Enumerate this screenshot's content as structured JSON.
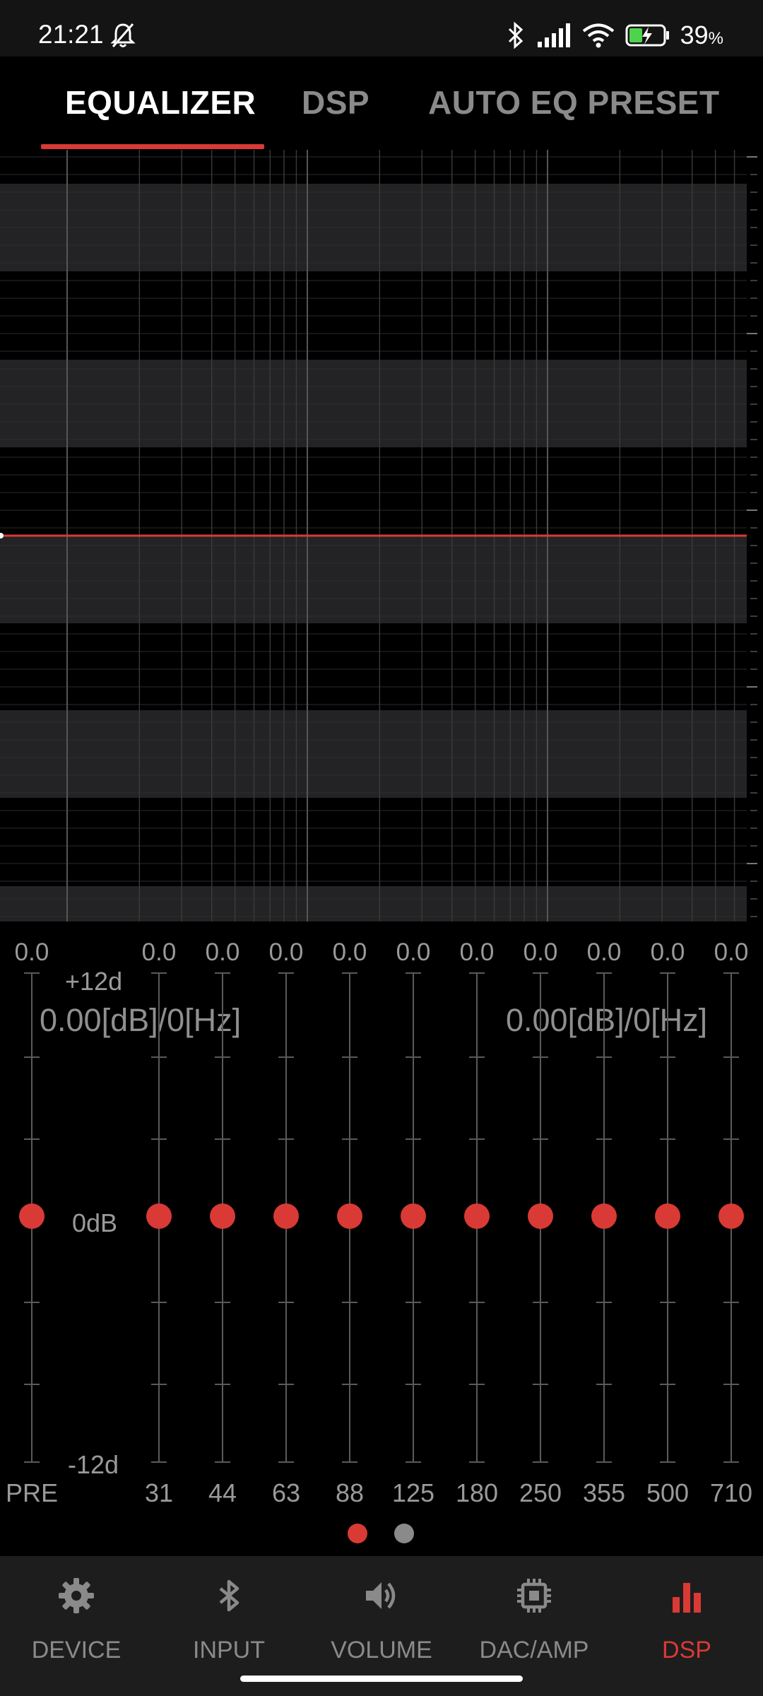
{
  "status_bar": {
    "time": "21:21",
    "battery": "39",
    "battery_unit": "%"
  },
  "tabs": [
    {
      "label": "EQUALIZER",
      "active": true
    },
    {
      "label": "DSP",
      "active": false
    },
    {
      "label": "AUTO EQ PRESET",
      "active": false
    }
  ],
  "graph": {
    "readout_left": "0.00[dB]/0[Hz]",
    "readout_right": "0.00[dB]/0[Hz]",
    "curve_color": "#d93a35"
  },
  "sliders": {
    "scale_top": "+12d",
    "scale_mid": "0dB",
    "scale_bottom": "-12d",
    "bands": [
      {
        "label": "PRE",
        "value": "0.0"
      },
      {
        "label": "31",
        "value": "0.0"
      },
      {
        "label": "44",
        "value": "0.0"
      },
      {
        "label": "63",
        "value": "0.0"
      },
      {
        "label": "88",
        "value": "0.0"
      },
      {
        "label": "125",
        "value": "0.0"
      },
      {
        "label": "180",
        "value": "0.0"
      },
      {
        "label": "250",
        "value": "0.0"
      },
      {
        "label": "355",
        "value": "0.0"
      },
      {
        "label": "500",
        "value": "0.0"
      },
      {
        "label": "710",
        "value": "0.0"
      }
    ]
  },
  "pager": {
    "pages": 2,
    "active_page": 1
  },
  "bottom_nav": [
    {
      "label": "DEVICE",
      "icon": "gear-icon",
      "active": false
    },
    {
      "label": "INPUT",
      "icon": "bluetooth-icon",
      "active": false
    },
    {
      "label": "VOLUME",
      "icon": "speaker-icon",
      "active": false
    },
    {
      "label": "DAC/AMP",
      "icon": "chip-icon",
      "active": false
    },
    {
      "label": "DSP",
      "icon": "bar-chart-icon",
      "active": true
    }
  ],
  "colors": {
    "accent": "#d93a35",
    "inactive": "#8a8a8a",
    "nav_bg": "#1d1d1d"
  }
}
